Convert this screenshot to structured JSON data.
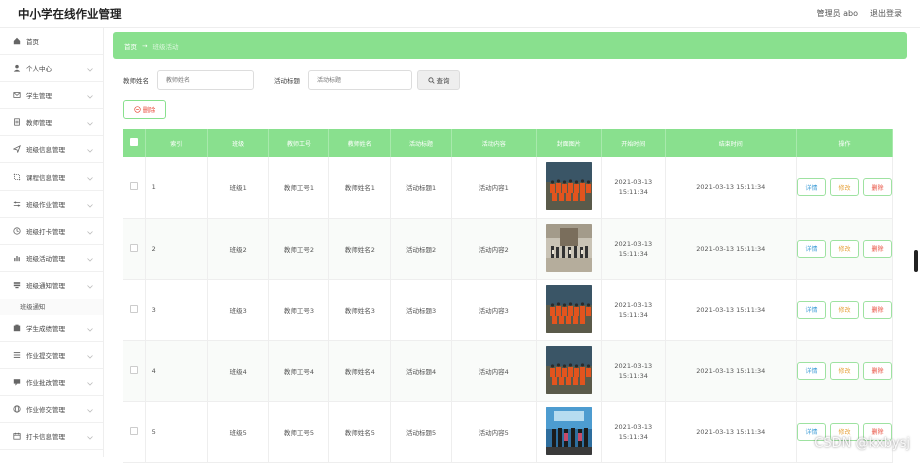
{
  "header": {
    "title": "中小学在线作业管理",
    "user_label": "管理员 abo",
    "logout_label": "退出登录"
  },
  "sidebar": {
    "items": [
      {
        "label": "首页",
        "icon": "home-icon",
        "has_chevron": false
      },
      {
        "label": "个人中心",
        "icon": "user-icon",
        "has_chevron": true
      },
      {
        "label": "学生管理",
        "icon": "mail-icon",
        "has_chevron": true
      },
      {
        "label": "教师管理",
        "icon": "doc-icon",
        "has_chevron": true
      },
      {
        "label": "班级信息管理",
        "icon": "send-icon",
        "has_chevron": true
      },
      {
        "label": "课程信息管理",
        "icon": "crop-icon",
        "has_chevron": true
      },
      {
        "label": "班级作业管理",
        "icon": "sliders-icon",
        "has_chevron": true
      },
      {
        "label": "班级打卡管理",
        "icon": "clock-icon",
        "has_chevron": true
      },
      {
        "label": "班级活动管理",
        "icon": "chart-icon",
        "has_chevron": true
      },
      {
        "label": "班级通知管理",
        "icon": "list-icon",
        "has_chevron": true,
        "open": true,
        "sub": "班级通知"
      },
      {
        "label": "学生成绩管理",
        "icon": "badge-icon",
        "has_chevron": true
      },
      {
        "label": "作业提交管理",
        "icon": "menu-icon",
        "has_chevron": true
      },
      {
        "label": "作业批改管理",
        "icon": "chat-icon",
        "has_chevron": true
      },
      {
        "label": "作业修交管理",
        "icon": "globe-icon",
        "has_chevron": true
      },
      {
        "label": "打卡信息管理",
        "icon": "calendar-icon",
        "has_chevron": true
      }
    ]
  },
  "breadcrumb": {
    "home": "首页",
    "arrow": "→",
    "current": "班级活动"
  },
  "filters": {
    "teacher_name_label": "教师姓名",
    "teacher_name_placeholder": "教师姓名",
    "activity_title_label": "活动标题",
    "activity_title_placeholder": "活动标题",
    "query_label": "查询"
  },
  "delete_label": "删除",
  "table": {
    "headers": [
      "索引",
      "班级",
      "教师工号",
      "教师姓名",
      "活动标题",
      "活动内容",
      "封面图片",
      "开始时间",
      "结束时间",
      "操作"
    ],
    "rows": [
      {
        "index": "1",
        "class": "班级1",
        "teacher_no": "教师工号1",
        "teacher_name": "教师姓名1",
        "title": "活动标题1",
        "content": "活动内容1",
        "image": "orange-group",
        "start": "2021-03-13 15:11:34",
        "end": "2021-03-13 15:11:34"
      },
      {
        "index": "2",
        "class": "班级2",
        "teacher_no": "教师工号2",
        "teacher_name": "教师姓名2",
        "title": "活动标题2",
        "content": "活动内容2",
        "image": "hall-group",
        "start": "2021-03-13 15:11:34",
        "end": "2021-03-13 15:11:34"
      },
      {
        "index": "3",
        "class": "班级3",
        "teacher_no": "教师工号3",
        "teacher_name": "教师姓名3",
        "title": "活动标题3",
        "content": "活动内容3",
        "image": "orange-group",
        "start": "2021-03-13 15:11:34",
        "end": "2021-03-13 15:11:34"
      },
      {
        "index": "4",
        "class": "班级4",
        "teacher_no": "教师工号4",
        "teacher_name": "教师姓名4",
        "title": "活动标题4",
        "content": "活动内容4",
        "image": "orange-group",
        "start": "2021-03-13 15:11:34",
        "end": "2021-03-13 15:11:34"
      },
      {
        "index": "5",
        "class": "班级5",
        "teacher_no": "教师工号5",
        "teacher_name": "教师姓名5",
        "title": "活动标题5",
        "content": "活动内容5",
        "image": "stage-group",
        "start": "2021-03-13 15:11:34",
        "end": "2021-03-13 15:11:34"
      }
    ],
    "ops": {
      "detail": "详情",
      "edit": "修改",
      "remove": "删除"
    }
  },
  "watermark": "CSDN @kxbysj",
  "colors": {
    "accent": "#89e08e",
    "danger": "#e74c3c",
    "info": "#3b9bd6",
    "warning": "#e6a23c"
  }
}
